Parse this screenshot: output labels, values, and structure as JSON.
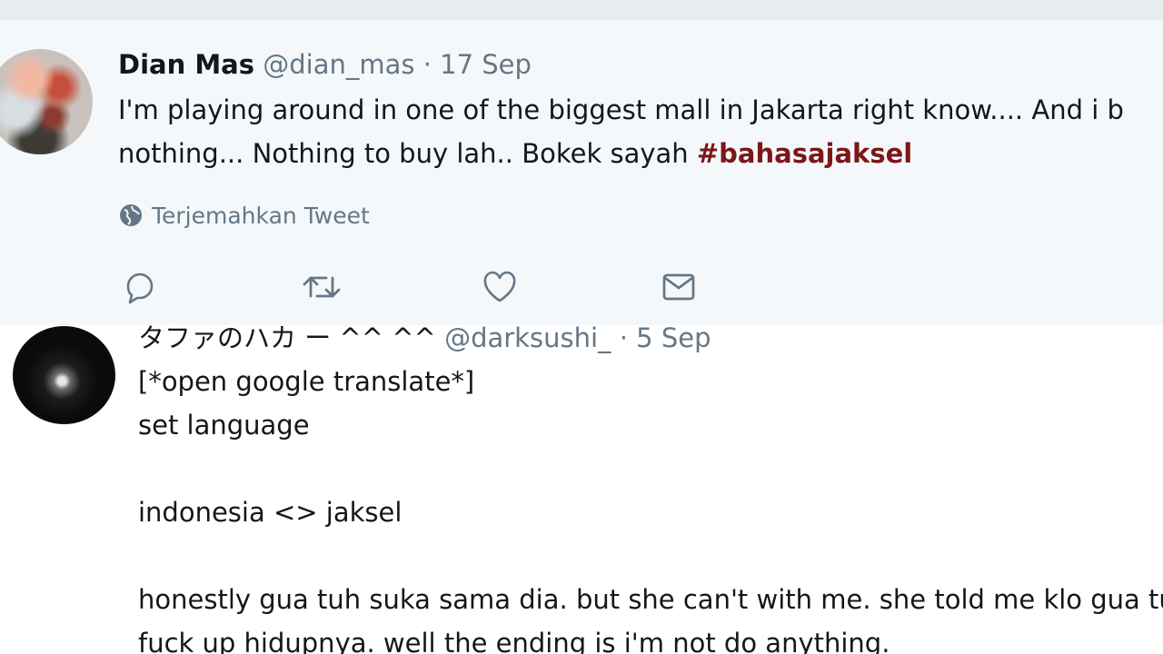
{
  "tweet1": {
    "name": "Dian Mas",
    "handle": "@dian_mas",
    "separator": "·",
    "date": "17 Sep",
    "line1": "I'm playing around in one of the biggest mall in Jakarta right know.... And i b",
    "line2_prefix": "nothing...  Nothing to buy lah.. Bokek sayah ",
    "hashtag": "#bahasajaksel",
    "translate_label": "Terjemahkan Tweet",
    "actions": [
      "reply-icon",
      "retweet-icon",
      "like-icon",
      "direct-message-icon"
    ]
  },
  "tweet2": {
    "name": "タファのハカ ー ^^ ^^",
    "handle": "@darksushi_",
    "separator": "·",
    "date": "5 Sep",
    "lines": [
      "[*open google translate*]",
      "set language",
      "",
      "indonesia <> jaksel",
      "",
      "honestly gua tuh suka sama dia. but she can't with me. she told me klo gua tu",
      "fuck up hidupnya. well the ending is i'm not do anything."
    ]
  },
  "colors": {
    "tweet1_background": "#f5f8fa",
    "muted_text": "#657786",
    "hashtag": "#7c1717"
  }
}
